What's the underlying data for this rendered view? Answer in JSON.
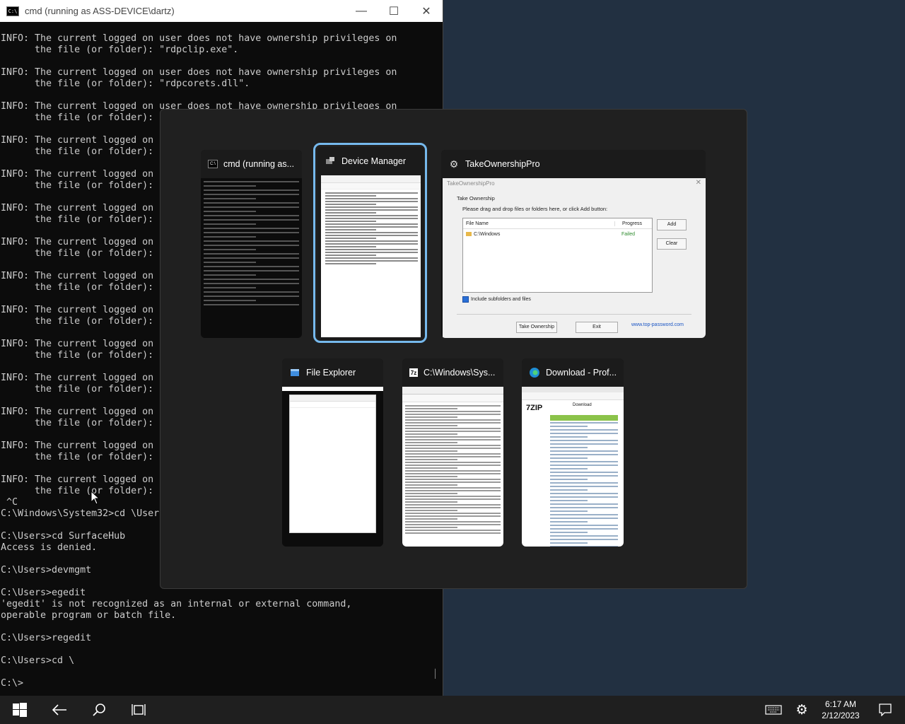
{
  "cmd": {
    "title": "cmd (running as ASS-DEVICE\\dartz)",
    "minimize": "—",
    "maximize": "☐",
    "close": "✕",
    "lines": [
      "INFO: The current logged on user does not have ownership privileges on",
      "      the file (or folder): \"rdpclip.exe\".",
      "",
      "INFO: The current logged on user does not have ownership privileges on",
      "      the file (or folder): \"rdpcorets.dll\".",
      "",
      "INFO: The current logged on user does not have ownership privileges on",
      "      the file (or folder):",
      "",
      "INFO: The current logged on",
      "      the file (or folder):",
      "",
      "INFO: The current logged on",
      "      the file (or folder):",
      "",
      "INFO: The current logged on",
      "      the file (or folder):",
      "",
      "INFO: The current logged on",
      "      the file (or folder):",
      "",
      "INFO: The current logged on",
      "      the file (or folder):",
      "",
      "INFO: The current logged on",
      "      the file (or folder):",
      "",
      "INFO: The current logged on",
      "      the file (or folder):",
      "",
      "INFO: The current logged on",
      "      the file (or folder):",
      "",
      "INFO: The current logged on",
      "      the file (or folder):",
      "",
      "INFO: The current logged on",
      "      the file (or folder):",
      "",
      "INFO: The current logged on",
      "      the file (or folder):",
      " ^C",
      "C:\\Windows\\System32>cd \\User",
      "",
      "C:\\Users>cd SurfaceHub",
      "Access is denied.",
      "",
      "C:\\Users>devmgmt",
      "",
      "C:\\Users>egedit",
      "'egedit' is not recognized as an internal or external command,",
      "operable program or batch file.",
      "",
      "C:\\Users>regedit",
      "",
      "C:\\Users>cd \\",
      "",
      "C:\\>"
    ]
  },
  "switcher": {
    "windows": [
      {
        "key": "cmd",
        "label": "cmd (running as..."
      },
      {
        "key": "devmgr",
        "label": "Device Manager"
      },
      {
        "key": "takeown",
        "label": "TakeOwnershipPro"
      },
      {
        "key": "explorer",
        "label": "File Explorer"
      },
      {
        "key": "syswow",
        "label": "C:\\Windows\\Sys..."
      },
      {
        "key": "browser",
        "label": "Download - Prof..."
      }
    ],
    "takeown": {
      "title": "TakeOwnershipPro",
      "heading": "Take Ownership",
      "instructions": "Please drag and drop files or folders here, or click Add button:",
      "col_file": "File Name",
      "col_progress": "Progress",
      "row_path": "C:\\Windows",
      "row_status": "Failed",
      "add": "Add",
      "clear": "Clear",
      "include": "Include subfolders and files",
      "take": "Take Ownership",
      "exit": "Exit",
      "link": "www.top-password.com"
    },
    "browser": {
      "logo": "7ZIP",
      "heading": "Download"
    }
  },
  "taskbar": {
    "time": "6:17 AM",
    "date": "2/12/2023"
  }
}
